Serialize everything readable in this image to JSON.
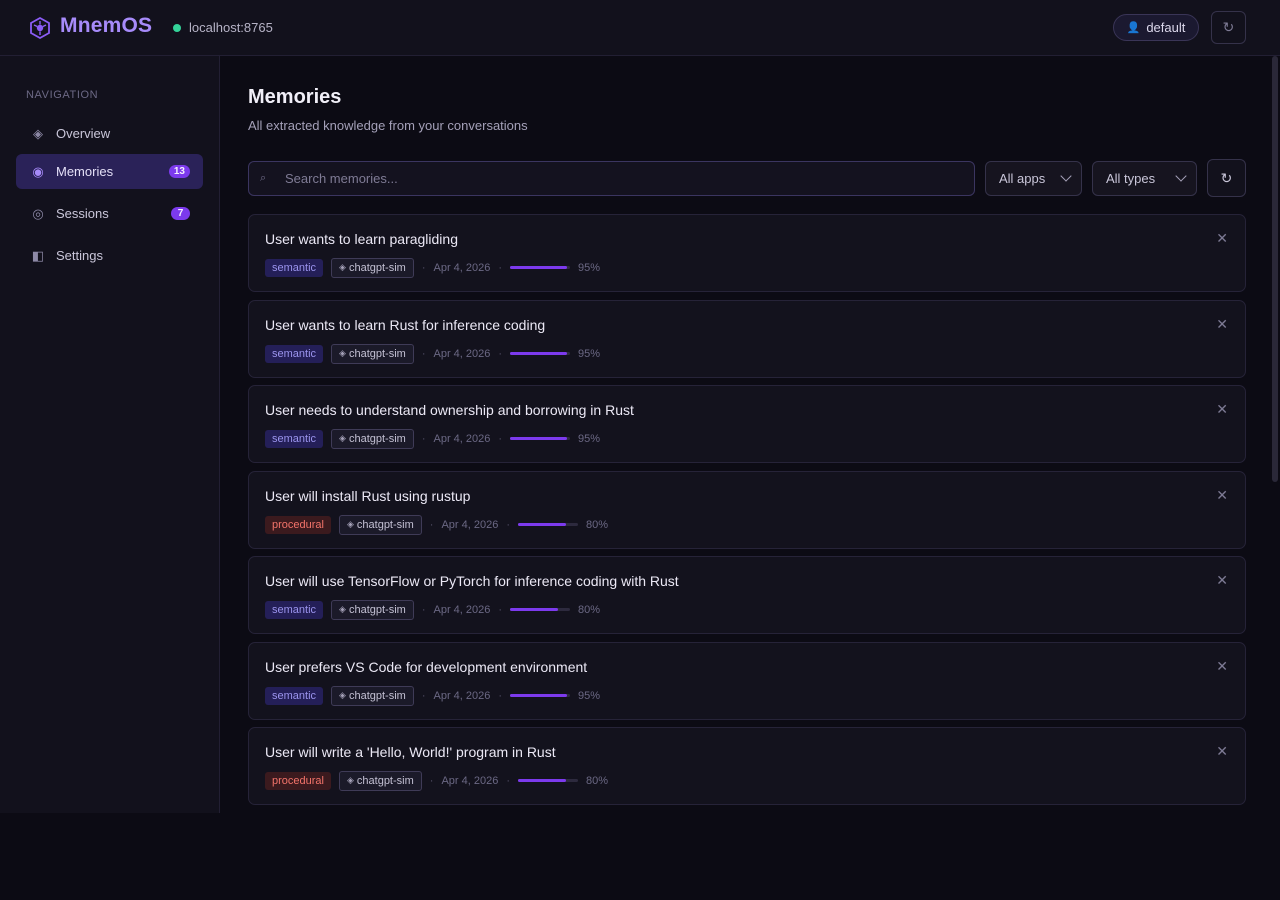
{
  "header": {
    "app_name": "MnemOS",
    "connection": "localhost:8765",
    "connection_status_color": "#34d399",
    "user": "default",
    "user_icon": "user-icon",
    "refresh_icon": "refresh-icon"
  },
  "sidebar": {
    "title": "NAVIGATION",
    "items": [
      {
        "label": "Overview",
        "icon": "overview-icon",
        "glyph": "◈",
        "active": false
      },
      {
        "label": "Memories",
        "icon": "memories-icon",
        "glyph": "◉",
        "active": true,
        "badge": "13"
      },
      {
        "label": "Sessions",
        "icon": "sessions-icon",
        "glyph": "◎",
        "active": false,
        "badge": "7"
      },
      {
        "label": "Settings",
        "icon": "settings-icon",
        "glyph": "◧",
        "active": false
      }
    ]
  },
  "main": {
    "title": "Memories",
    "subtitle": "All extracted knowledge from your conversations",
    "search": {
      "placeholder": "Search memories...",
      "value": ""
    },
    "filters": {
      "apps": "All apps",
      "types": "All types"
    }
  },
  "accent_color": "#7c3aed",
  "memories": [
    {
      "title": "User wants to learn paragliding",
      "type": "semantic",
      "app": "chatgpt-sim",
      "date": "Apr 4, 2026",
      "confidence": 0.95,
      "confidence_label": "95%"
    },
    {
      "title": "User wants to learn Rust for inference coding",
      "type": "semantic",
      "app": "chatgpt-sim",
      "date": "Apr 4, 2026",
      "confidence": 0.95,
      "confidence_label": "95%"
    },
    {
      "title": "User needs to understand ownership and borrowing in Rust",
      "type": "semantic",
      "app": "chatgpt-sim",
      "date": "Apr 4, 2026",
      "confidence": 0.95,
      "confidence_label": "95%"
    },
    {
      "title": "User will install Rust using rustup",
      "type": "procedural",
      "app": "chatgpt-sim",
      "date": "Apr 4, 2026",
      "confidence": 0.8,
      "confidence_label": "80%"
    },
    {
      "title": "User will use TensorFlow or PyTorch for inference coding with Rust",
      "type": "semantic",
      "app": "chatgpt-sim",
      "date": "Apr 4, 2026",
      "confidence": 0.8,
      "confidence_label": "80%"
    },
    {
      "title": "User prefers VS Code for development environment",
      "type": "semantic",
      "app": "chatgpt-sim",
      "date": "Apr 4, 2026",
      "confidence": 0.95,
      "confidence_label": "95%"
    },
    {
      "title": "User will write a 'Hello, World!' program in Rust",
      "type": "procedural",
      "app": "chatgpt-sim",
      "date": "Apr 4, 2026",
      "confidence": 0.8,
      "confidence_label": "80%"
    }
  ]
}
